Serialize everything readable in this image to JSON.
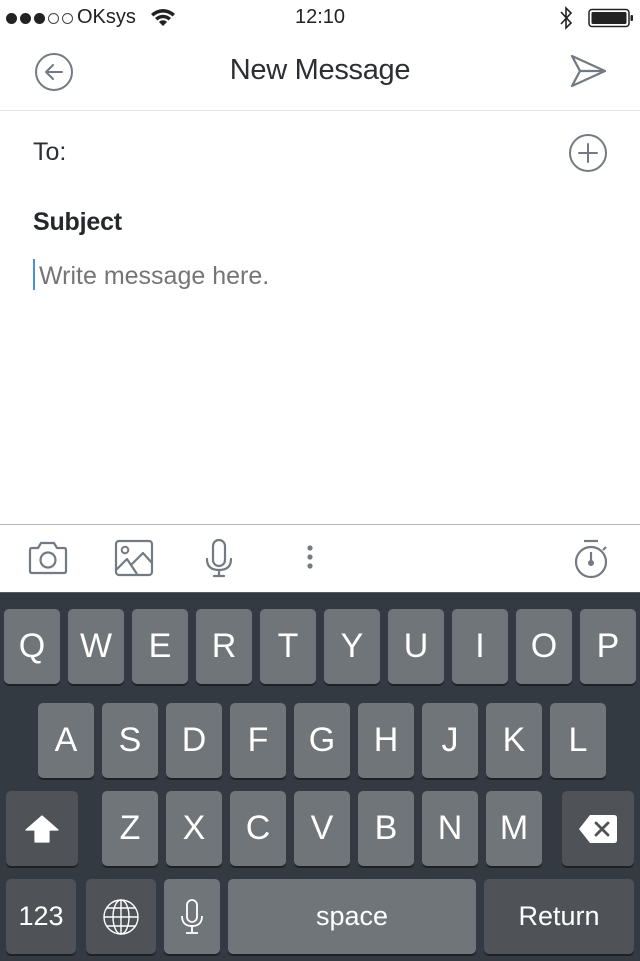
{
  "status_bar": {
    "signal_strength": {
      "filled": 3,
      "total": 5
    },
    "carrier": "OKsys",
    "wifi_icon": "wifi-icon",
    "time": "12:10",
    "bluetooth_icon": "bluetooth-icon",
    "battery_icon": "battery-icon",
    "battery_level": 1.0
  },
  "nav": {
    "back_icon": "back-arrow-circle-icon",
    "title": "New Message",
    "send_icon": "send-icon"
  },
  "compose": {
    "to_label": "To:",
    "add_recipient_icon": "plus-circle-icon",
    "subject_label": "Subject",
    "body_placeholder": "Write message here.",
    "body_value": ""
  },
  "toolbar": {
    "items": [
      "camera-icon",
      "image-icon",
      "microphone-icon",
      "more-vertical-icon"
    ],
    "timer_icon": "stopwatch-icon"
  },
  "keyboard": {
    "row1": [
      "Q",
      "W",
      "E",
      "R",
      "T",
      "Y",
      "U",
      "I",
      "O",
      "P"
    ],
    "row2": [
      "A",
      "S",
      "D",
      "F",
      "G",
      "H",
      "J",
      "K",
      "L"
    ],
    "row3": [
      "Z",
      "X",
      "C",
      "V",
      "B",
      "N",
      "M"
    ],
    "shift_icon": "shift-icon",
    "backspace_icon": "backspace-icon",
    "numbers_label": "123",
    "globe_icon": "globe-icon",
    "dictation_icon": "microphone-icon",
    "space_label": "space",
    "return_label": "Return"
  },
  "colors": {
    "icon_gray": "#737a82",
    "caret": "#4a90d9",
    "keyboard_bg": "#343a41",
    "key_bg": "#70757a",
    "special_key_bg": "#4f5358"
  }
}
